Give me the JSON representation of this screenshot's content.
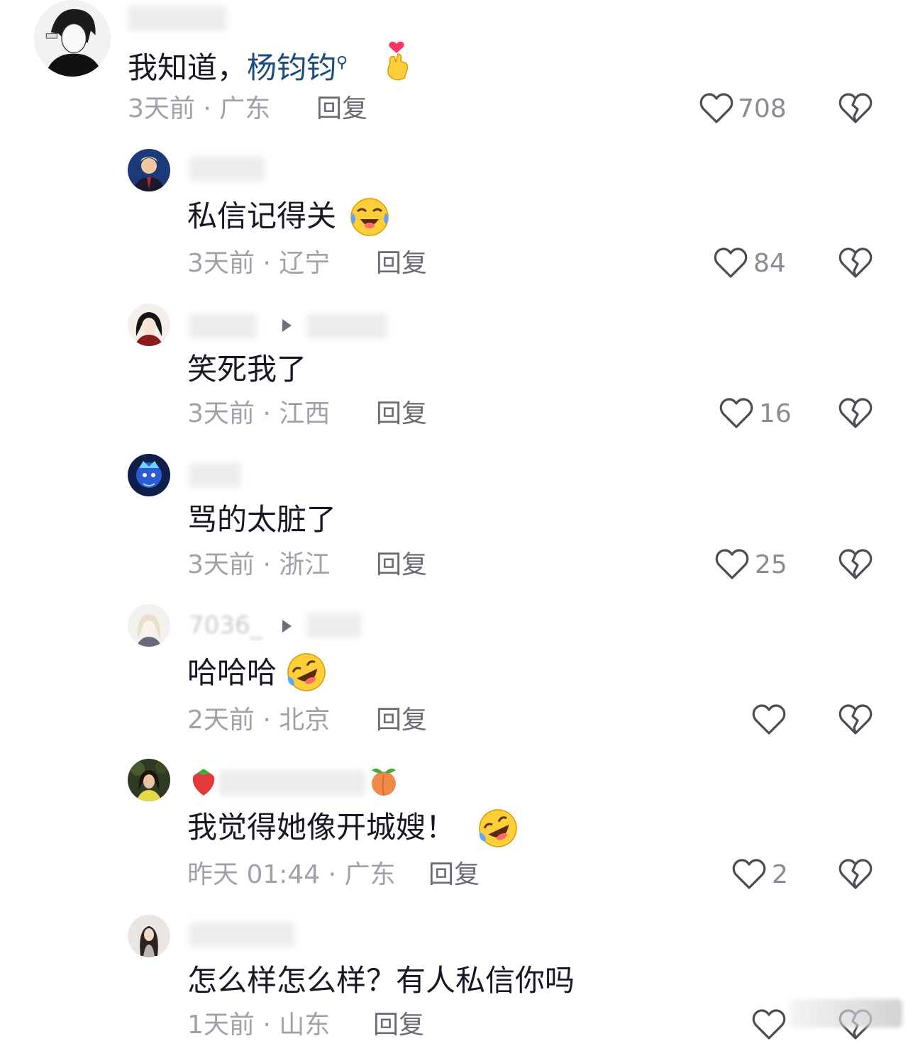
{
  "comments": [
    {
      "text_before": "我知道，",
      "mention": "杨钧钧",
      "time": "3天前",
      "location": "广东",
      "reply_label": "回复",
      "likes": "708",
      "emoji": "pinched-heart-hand-emoji"
    },
    {
      "text": "私信记得关",
      "time": "3天前",
      "location": "辽宁",
      "reply_label": "回复",
      "likes": "84",
      "emoji": "tears-of-joy-emoji"
    },
    {
      "text": "笑死我了",
      "time": "3天前",
      "location": "江西",
      "reply_label": "回复",
      "likes": "16"
    },
    {
      "text": "骂的太脏了",
      "time": "3天前",
      "location": "浙江",
      "reply_label": "回复",
      "likes": "25"
    },
    {
      "username_partial": "7036_",
      "text": "哈哈哈",
      "time": "2天前",
      "location": "北京",
      "reply_label": "回复",
      "likes": "",
      "emoji": "rolling-laughing-emoji"
    },
    {
      "text": "我觉得她像开城嫂！",
      "time": "昨天 01:44",
      "location": "广东",
      "reply_label": "回复",
      "likes": "2",
      "emoji": "rolling-laughing-emoji"
    },
    {
      "text": "怎么样怎么样？有人私信你吗",
      "time": "1天前",
      "location": "山东",
      "reply_label": "回复",
      "likes": ""
    }
  ],
  "separator": " · ",
  "colors": {
    "mention": "#1a4d7a",
    "meta": "#a0a1a8",
    "icon": "#4b4c54"
  },
  "icons": {
    "like": "heart-outline-icon",
    "dislike": "broken-heart-icon"
  }
}
